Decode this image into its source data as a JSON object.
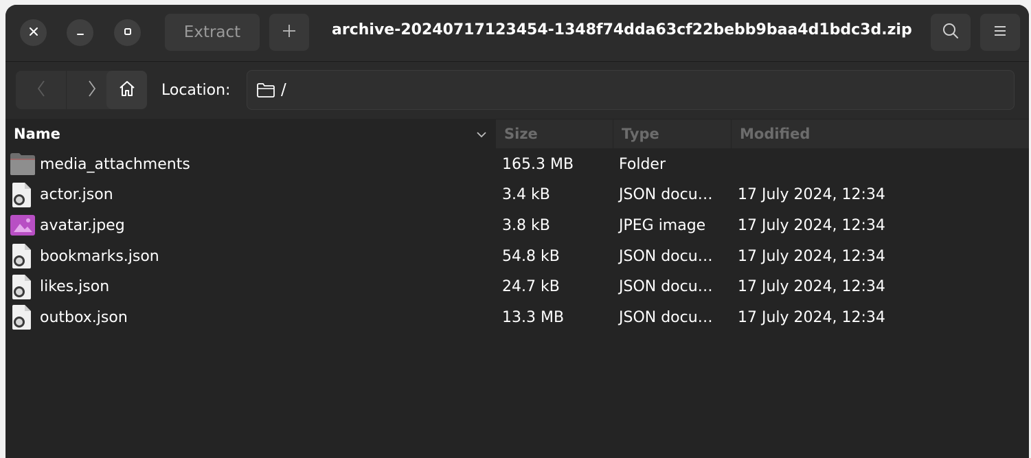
{
  "window": {
    "title": "archive-20240717123454-1348f74dda63cf22bebb9baa4d1bdc3d.zip",
    "extract_label": "Extract",
    "controls": [
      "close-icon",
      "minimize-icon",
      "maximize-icon"
    ]
  },
  "toolbar": {
    "location_label": "Location:",
    "location_path": "/"
  },
  "columns": {
    "name": "Name",
    "size": "Size",
    "type": "Type",
    "modified": "Modified"
  },
  "files": [
    {
      "icon": "folder-icon",
      "name": "media_attachments",
      "size": "165.3 MB",
      "type": "Folder",
      "modified": ""
    },
    {
      "icon": "json-file-icon",
      "name": "actor.json",
      "size": "3.4 kB",
      "type": "JSON docu…",
      "modified": "17 July 2024, 12:34"
    },
    {
      "icon": "image-file-icon",
      "name": "avatar.jpeg",
      "size": "3.8 kB",
      "type": "JPEG image",
      "modified": "17 July 2024, 12:34"
    },
    {
      "icon": "json-file-icon",
      "name": "bookmarks.json",
      "size": "54.8 kB",
      "type": "JSON docu…",
      "modified": "17 July 2024, 12:34"
    },
    {
      "icon": "json-file-icon",
      "name": "likes.json",
      "size": "24.7 kB",
      "type": "JSON docu…",
      "modified": "17 July 2024, 12:34"
    },
    {
      "icon": "json-file-icon",
      "name": "outbox.json",
      "size": "13.3 MB",
      "type": "JSON docu…",
      "modified": "17 July 2024, 12:34"
    }
  ],
  "colors": {
    "window_bg": "#242424",
    "header_bg": "#2c2c2c",
    "folder": "#8e8e8e",
    "image_icon": "#b84fc4"
  }
}
